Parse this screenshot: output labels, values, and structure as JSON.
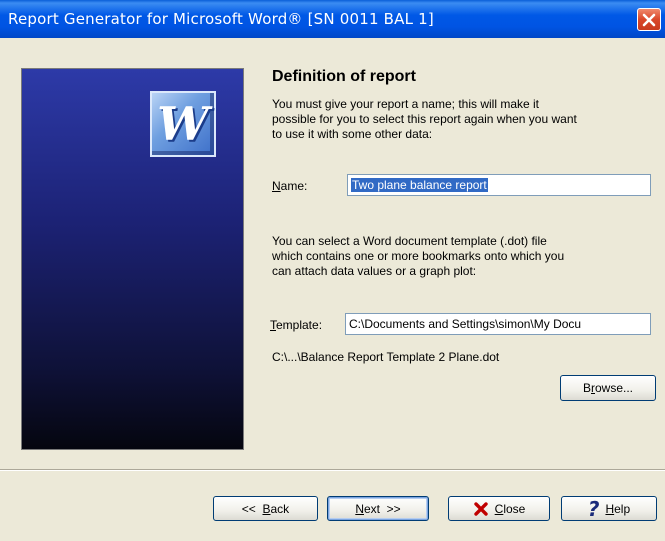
{
  "window": {
    "title": "Report Generator for Microsoft Word® [SN 0011 BAL 1]"
  },
  "icons": {
    "close": "close-icon",
    "logo": "word-logo-icon",
    "close_button": "red-x-icon",
    "help_button": "question-icon"
  },
  "colors": {
    "titlebar": "#0054e3",
    "selection": "#316ac5",
    "panel": "#1c2275"
  },
  "logo": {
    "letter": "W"
  },
  "content": {
    "heading": "Definition of report",
    "intro_line1": "You must give your report a name; this will make it",
    "intro_line2": "possible for you to select this report again when you want",
    "intro_line3": "to use it with some other data:",
    "name_label_accel": "N",
    "name_label_rest": "ame:",
    "name_value": "Two plane balance report",
    "template_line1": "You can select a Word document template (.dot) file",
    "template_line2": "which contains one or more bookmarks onto which you",
    "template_line3": "can attach data values or a graph plot:",
    "template_label_accel": "T",
    "template_label_rest": "emplate:",
    "template_value": "C:\\Documents and Settings\\simon\\My Docu",
    "template_short_path": "C:\\...\\Balance Report Template 2 Plane.dot"
  },
  "buttons": {
    "browse_pre": "B",
    "browse_accel": "r",
    "browse_post": "owse...",
    "back_pre": "<<  ",
    "back_accel": "B",
    "back_post": "ack",
    "next_accel": "N",
    "next_post": "ext  >>",
    "close_accel": "C",
    "close_post": "lose",
    "help_accel": "H",
    "help_post": "elp"
  }
}
